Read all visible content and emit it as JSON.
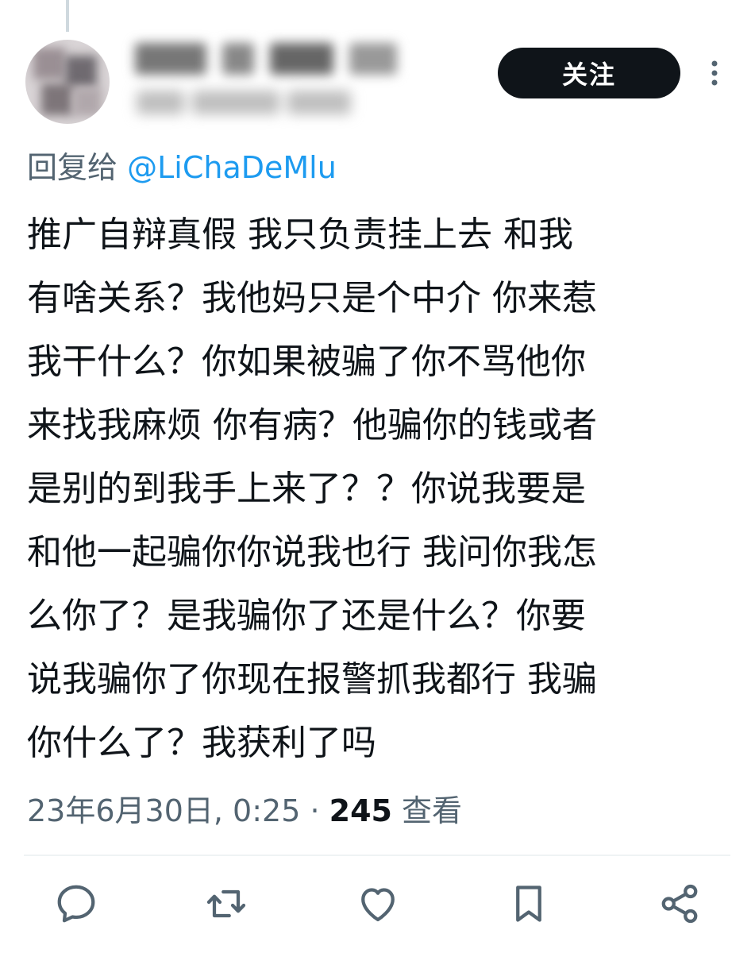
{
  "post": {
    "follow_label": "关注",
    "reply_prefix": "回复给 ",
    "reply_mention": "@LiChaDeMlu",
    "text_lines": [
      "推广自辩真假 我只负责挂上去 和我",
      "有啥关系？我他妈只是个中介 你来惹",
      "我干什么？你如果被骗了你不骂他你",
      "来找我麻烦 你有病？他骗你的钱或者",
      "是别的到我手上来了？？你说我要是",
      "和他一起骗你你说我也行 我问你我怎",
      "么你了？是我骗你了还是什么？你要",
      "说我骗你了你现在报警抓我都行 我骗",
      "你什么了？我获利了吗"
    ],
    "timestamp": "23年6月30日, 0:25 · ",
    "views_count": "245",
    "views_label": " 查看"
  },
  "icons": {
    "more": "more-vertical-icon",
    "reply": "reply-icon",
    "repost": "repost-icon",
    "like": "like-icon",
    "bookmark": "bookmark-icon",
    "share": "share-icon"
  },
  "colors": {
    "text": "#0f1419",
    "secondary": "#536471",
    "link": "#1d9bf0",
    "button_bg": "#0f1419"
  }
}
